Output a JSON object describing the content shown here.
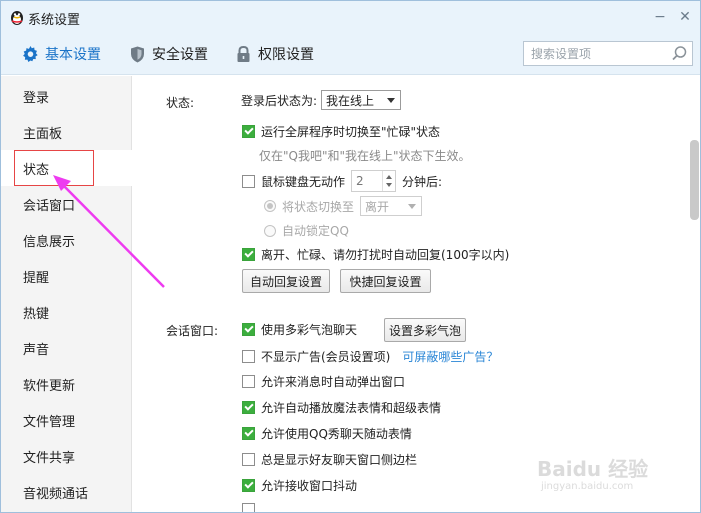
{
  "window": {
    "title": "系统设置",
    "minimize_glyph": "−",
    "close_glyph": "✕"
  },
  "tabs": [
    {
      "label": "基本设置",
      "icon": "gear-icon",
      "active": true
    },
    {
      "label": "安全设置",
      "icon": "shield-icon",
      "active": false
    },
    {
      "label": "权限设置",
      "icon": "lock-icon",
      "active": false
    }
  ],
  "search": {
    "placeholder": "搜索设置项"
  },
  "sidebar": {
    "items": [
      {
        "label": "登录"
      },
      {
        "label": "主面板"
      },
      {
        "label": "状态",
        "active": true
      },
      {
        "label": "会话窗口"
      },
      {
        "label": "信息展示"
      },
      {
        "label": "提醒"
      },
      {
        "label": "热键"
      },
      {
        "label": "声音"
      },
      {
        "label": "软件更新"
      },
      {
        "label": "文件管理"
      },
      {
        "label": "文件共享"
      },
      {
        "label": "音视频通话"
      }
    ]
  },
  "status_section": {
    "label": "状态:",
    "login_status_label": "登录后状态为:",
    "login_status_value": "我在线上",
    "fullscreen_busy": {
      "label": "运行全屏程序时切换至\"忙碌\"状态",
      "checked": true
    },
    "fullscreen_hint": "仅在\"Q我吧\"和\"我在线上\"状态下生效。",
    "idle": {
      "label": "鼠标键盘无动作",
      "value": "2",
      "suffix": "分钟后:",
      "checked": false
    },
    "idle_switch": {
      "label": "将状态切换至",
      "value": "离开",
      "selected": true
    },
    "idle_lock": {
      "label": "自动锁定QQ",
      "selected": false
    },
    "auto_reply": {
      "label": "离开、忙碌、请勿打扰时自动回复(100字以内)",
      "checked": true
    },
    "buttons": {
      "auto_reply_settings": "自动回复设置",
      "quick_reply_settings": "快捷回复设置"
    }
  },
  "chat_section": {
    "label": "会话窗口:",
    "options": [
      {
        "label": "使用多彩气泡聊天",
        "checked": true
      },
      {
        "label": "不显示广告(会员设置项)",
        "checked": false
      },
      {
        "label": "允许来消息时自动弹出窗口",
        "checked": false
      },
      {
        "label": "允许自动播放魔法表情和超级表情",
        "checked": true
      },
      {
        "label": "允许使用QQ秀聊天随动表情",
        "checked": true
      },
      {
        "label": "总是显示好友聊天窗口侧边栏",
        "checked": false
      },
      {
        "label": "允许接收窗口抖动",
        "checked": true
      }
    ],
    "bubble_button": "设置多彩气泡",
    "ads_link": "可屏蔽哪些广告？"
  },
  "watermark": {
    "line1": "Baidu 经验",
    "line2": "jingyan.baidu.com"
  },
  "colors": {
    "accent": "#1a73c8",
    "check": "#3cae3e",
    "highlight": "#e64545",
    "arrow": "#ee3bf0"
  }
}
